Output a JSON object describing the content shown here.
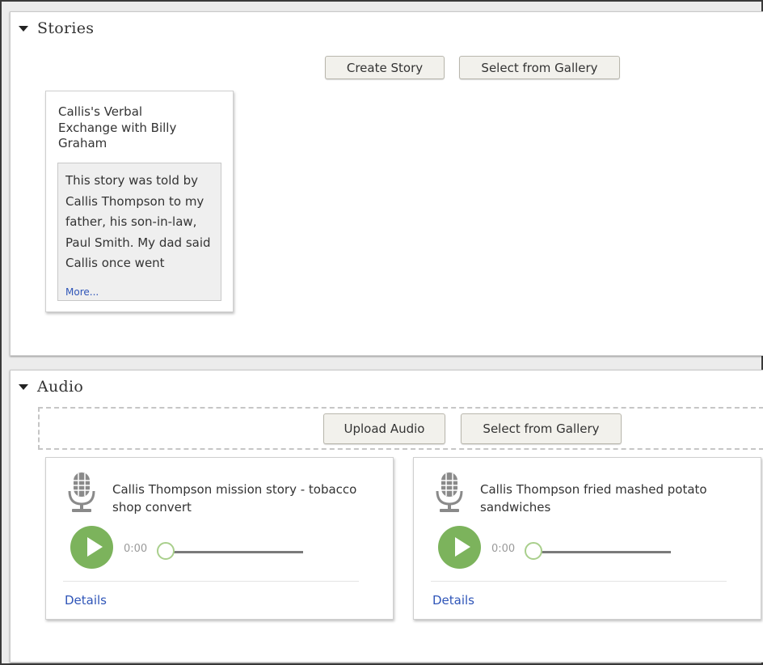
{
  "stories": {
    "title": "Stories",
    "create_button": "Create Story",
    "gallery_button": "Select from Gallery",
    "cards": [
      {
        "title": "Callis's Verbal Exchange with Billy Graham",
        "excerpt": "This story was told by Callis Thompson to my father, his son-in-law, Paul Smith. My dad said Callis once went",
        "more_link": "More..."
      }
    ]
  },
  "audio": {
    "title": "Audio",
    "upload_button": "Upload Audio",
    "gallery_button": "Select from Gallery",
    "items": [
      {
        "icon": "microphone-icon",
        "title": "Callis Thompson mission story - tobacco shop convert",
        "time": "0:00",
        "progress": 0,
        "details_link": "Details"
      },
      {
        "icon": "microphone-icon",
        "title": "Callis Thompson fried mashed potato sandwiches",
        "time": "0:00",
        "progress": 0,
        "details_link": "Details"
      }
    ]
  },
  "colors": {
    "play_button": "#7cb35c",
    "link": "#2f55b8",
    "slider_thumb_border": "#a9cf8c"
  }
}
